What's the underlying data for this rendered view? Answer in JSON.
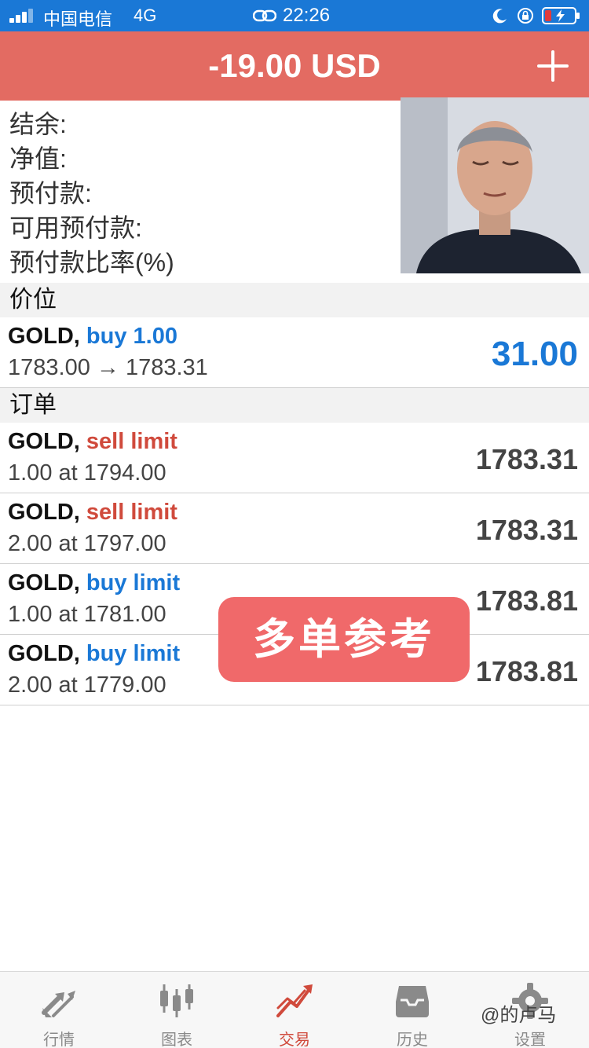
{
  "status_bar": {
    "carrier": "中国电信",
    "network": "4G",
    "time": "22:26"
  },
  "header": {
    "title": "-19.00 USD"
  },
  "summary": {
    "labels": [
      "结余:",
      "净值:",
      "预付款:",
      "可用预付款:",
      "预付款比率(%)"
    ]
  },
  "positions": {
    "section_title": "价位",
    "items": [
      {
        "symbol": "GOLD,",
        "action": "buy 1.00",
        "action_color": "blue",
        "detail": "1783.00 → 1783.31",
        "value": "31.00"
      }
    ]
  },
  "orders": {
    "section_title": "订单",
    "items": [
      {
        "symbol": "GOLD,",
        "action": "sell limit",
        "action_color": "red",
        "detail": "1.00 at 1794.00",
        "value": "1783.31"
      },
      {
        "symbol": "GOLD,",
        "action": "sell limit",
        "action_color": "red",
        "detail": "2.00 at 1797.00",
        "value": "1783.31"
      },
      {
        "symbol": "GOLD,",
        "action": "buy limit",
        "action_color": "blue",
        "detail": "1.00 at 1781.00",
        "value": "1783.81"
      },
      {
        "symbol": "GOLD,",
        "action": "buy limit",
        "action_color": "blue",
        "detail": "2.00 at 1779.00",
        "value": "1783.81"
      }
    ]
  },
  "overlay": {
    "stamp_text": "多单参考",
    "watermark": "@的卢马"
  },
  "tabs": [
    {
      "label": "行情",
      "icon": "quotes-arrows-icon",
      "active": false
    },
    {
      "label": "图表",
      "icon": "candlestick-chart-icon",
      "active": false
    },
    {
      "label": "交易",
      "icon": "trade-trend-icon",
      "active": true
    },
    {
      "label": "历史",
      "icon": "history-inbox-icon",
      "active": false
    },
    {
      "label": "设置",
      "icon": "settings-gear-icon",
      "active": false
    }
  ],
  "colors": {
    "header": "#e36b62",
    "status_bar": "#1a78d6",
    "blue": "#1a78d6",
    "red": "#d04a3c",
    "stamp": "#f0696a"
  }
}
